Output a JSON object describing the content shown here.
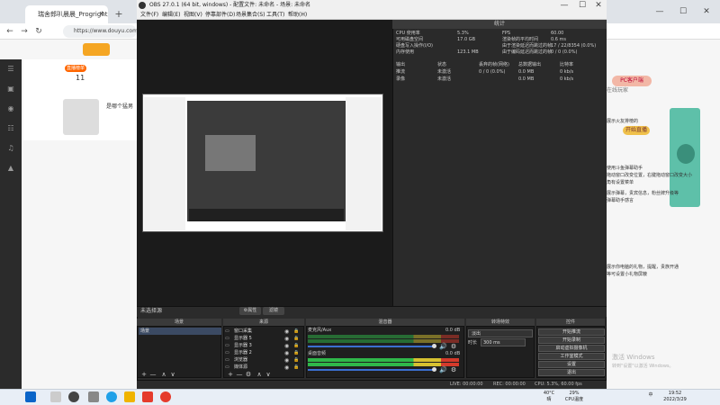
{
  "colors": {
    "obs_bg": "#2b2b2b",
    "browser_accent": "#f5a623",
    "meter_green": "#2fb84a",
    "meter_yellow": "#d6c130",
    "meter_red": "#d43a2b",
    "slider_blue": "#3b6fd1"
  },
  "browser": {
    "tab_title": "瑞舍郎叭晨晨_Progright直播_斗鱼...",
    "tab_close": "✕",
    "new_tab": "+",
    "url": "https://www.douyu.com/99",
    "hot_badge": "直播榜单",
    "count": "11",
    "question": "是哪个猛男",
    "right_badge": "PC客户端",
    "right_btn": "开始直播",
    "right_small": "在线玩家",
    "nav_back": "←",
    "nav_forward": "→",
    "nav_refresh": "↻",
    "minimize": "—",
    "maximize": "☐",
    "close": "✕",
    "sidebar_icons": [
      "☰",
      "▣",
      "◉",
      "☷",
      "♫",
      "▲"
    ]
  },
  "obs": {
    "title": "OBS 27.0.1 (64 bit, windows) - 配置文件: 未命名 - 场景: 未命名",
    "menu": [
      "文件(F)",
      "编辑(E)",
      "视图(V)",
      "停靠部件(D)",
      "场景集合(S)",
      "工具(T)",
      "帮助(H)"
    ],
    "stats": {
      "title": "统计",
      "left_labels": [
        "CPU 使用率",
        "可用磁盘空间",
        "硬盘写入操作(I/O)",
        "内存使用"
      ],
      "left_values": [
        "5.3%",
        "17.0 GB",
        "",
        "123.1 MB"
      ],
      "right_labels": [
        "FPS",
        "渲染帧的平均时间",
        "由于渲染延迟而跳过的帧",
        "由于编码延迟而跳过的帧"
      ],
      "right_values": [
        "60.00",
        "0.6 ms",
        "17 / 22/8354 (0.0%)",
        "0 / 0 (0.0%)"
      ],
      "table_headers": [
        "输出",
        "状态",
        "丢弃的帧(网络)",
        "总数据输出",
        "比特率"
      ],
      "rows": [
        [
          "推流",
          "未激活",
          "0 / 0 (0.0%)",
          "0.0 MB",
          "0 kb/s"
        ],
        [
          "录像",
          "未激活",
          "",
          "0.0 MB",
          "0 kb/s"
        ]
      ],
      "reset": "重置"
    },
    "scene_label": "未选择源",
    "props_btn": "⚙属性",
    "filter_btn": "滤镜",
    "docks": {
      "scenes": "场景",
      "sources": "来源",
      "mixer": "混音器",
      "transitions": "转场特效",
      "controls": "控件"
    },
    "scene_item": "场景",
    "sources": [
      {
        "icon": "▭",
        "name": "窗口采集"
      },
      {
        "icon": "▭",
        "name": "显示器 5"
      },
      {
        "icon": "▭",
        "name": "显示器 3"
      },
      {
        "icon": "▭",
        "name": "显示器 2"
      },
      {
        "icon": "▭",
        "name": "浏览器"
      },
      {
        "icon": "▭",
        "name": "媒体源"
      }
    ],
    "eye": "◉",
    "lock": "🔒",
    "dock_add": "+",
    "dock_remove": "—",
    "dock_gear": "⚙",
    "dock_up": "∧",
    "dock_down": "∨",
    "mixer": [
      {
        "name": "桌面音频",
        "db": "0.0 dB"
      },
      {
        "name": "麦克风/Aux",
        "db": "0.0 dB"
      }
    ],
    "speaker": "🔊",
    "mixer_gear": "⚙",
    "transition": {
      "type": "淡出",
      "duration_label": "时长",
      "duration": "300 ms"
    },
    "controls": [
      "开始推流",
      "开始录制",
      "启动虚拟摄像机",
      "工作室模式",
      "设置",
      "退出"
    ],
    "status": {
      "live": "LIVE: 00:00:00",
      "rec": "REC: 00:00:00",
      "cpu": "CPU: 5.3%, 60.00 fps"
    }
  },
  "overlay_text": [
    "这里展示火友排榜的",
    "欢迎使用斗鱼弹幕助手",
    "左键拖动窗口改变位置，右键拖动窗口改变大小",
    "右上角有设置菜单",
    "这里展示弹幕，贵宾信息，粉丝牌升级等",
    "涨加弹幕助手感言",
    "这里展示你电脑的礼物，提醒，贵族开通",
    "点赞等可设置小礼物屏蔽"
  ],
  "watermark": {
    "line1": "激活 Windows",
    "line2": "转到\"设置\"以激活 Windows。"
  },
  "taskbar": {
    "weather": "40°C",
    "weather_sub": "晴",
    "cpu_pct": "29%",
    "cpu_label": "CPU温度",
    "time": "19:52",
    "date": "2022/3/29",
    "ime": "中"
  }
}
